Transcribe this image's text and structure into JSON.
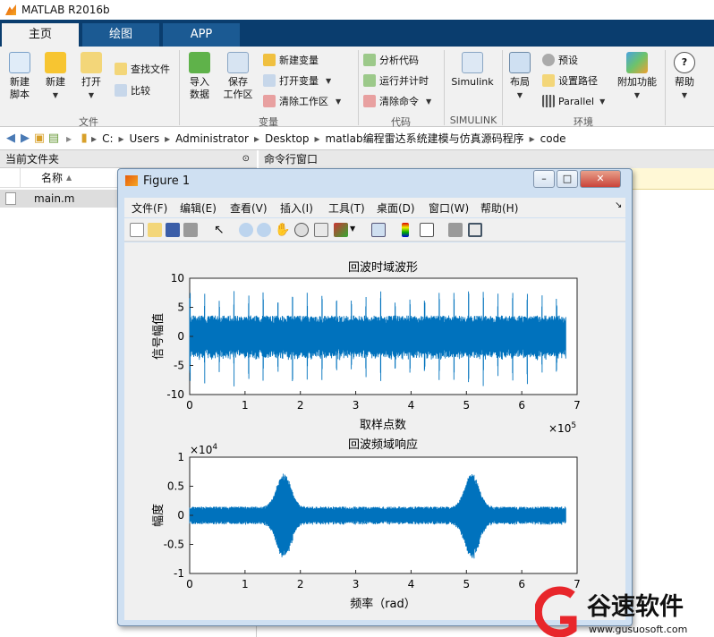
{
  "app": {
    "title": "MATLAB R2016b"
  },
  "tabs": [
    {
      "label": "主页"
    },
    {
      "label": "绘图"
    },
    {
      "label": "APP"
    }
  ],
  "ribbon": {
    "new_script": "新建\n脚本",
    "new": "新建",
    "open": "打开",
    "find_files": "查找文件",
    "compare": "比较",
    "import_data": "导入\n数据",
    "save_workspace": "保存\n工作区",
    "new_variable": "新建变量",
    "open_variable": "打开变量",
    "clear_workspace": "清除工作区",
    "analyze_code": "分析代码",
    "run_and_time": "运行并计时",
    "clear_commands": "清除命令",
    "simulink": "Simulink",
    "layout": "布局",
    "preferences": "预设",
    "set_path": "设置路径",
    "parallel": "Parallel",
    "add_ons": "附加功能",
    "help": "帮助",
    "groups": {
      "file": "文件",
      "variable": "变量",
      "code": "代码",
      "simulink": "SIMULINK",
      "environment": "环境"
    }
  },
  "address": {
    "crumbs": [
      "C:",
      "Users",
      "Administrator",
      "Desktop",
      "matlab编程雷达系统建模与仿真源码程序",
      "code"
    ]
  },
  "current_folder": {
    "title": "当前文件夹",
    "column": "名称",
    "files": [
      "main.m"
    ]
  },
  "command_window": {
    "title": "命令行窗口"
  },
  "figure": {
    "title": "Figure 1",
    "menu": [
      "文件(F)",
      "编辑(E)",
      "查看(V)",
      "插入(I)",
      "工具(T)",
      "桌面(D)",
      "窗口(W)",
      "帮助(H)"
    ]
  },
  "chart_data": [
    {
      "type": "line",
      "title": "回波时域波形",
      "xlabel": "取样点数",
      "ylabel": "信号幅值",
      "x_multiplier": "×10^5",
      "xlim": [
        0,
        7
      ],
      "ylim": [
        -10,
        10
      ],
      "xticks": [
        0,
        1,
        2,
        3,
        4,
        5,
        6,
        7
      ],
      "yticks": [
        10,
        5,
        0,
        -5,
        -10
      ],
      "series": [
        {
          "color": "#0072bd",
          "description": "dense noise band about ±3.5 with periodic spikes up to ~±7.5",
          "x_end": 6.8
        }
      ]
    },
    {
      "type": "line",
      "title": "回波频域响应",
      "xlabel": "频率（rad）",
      "ylabel": "幅度",
      "y_multiplier": "×10^4",
      "xlim": [
        0,
        7
      ],
      "ylim": [
        -1,
        1
      ],
      "xticks": [
        0,
        1,
        2,
        3,
        4,
        5,
        6,
        7
      ],
      "yticks": [
        1,
        0.5,
        0,
        -0.5,
        -1
      ],
      "series": [
        {
          "color": "#0072bd",
          "description": "noise band ±0.15 with envelope peaks ~±0.75 near x=1.7 and x=5.1",
          "x_end": 6.8
        }
      ]
    }
  ],
  "watermark": {
    "brand": "谷速软件",
    "url": "www.gusuosoft.com"
  }
}
